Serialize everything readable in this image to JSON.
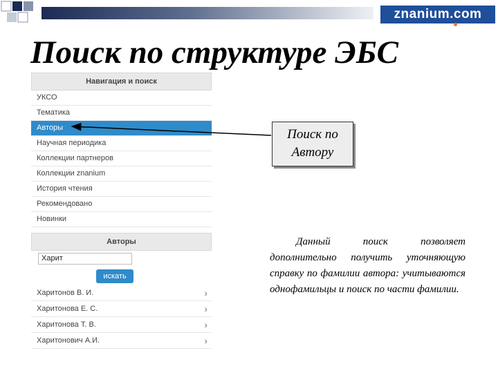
{
  "slide": {
    "title": "Поиск по структуре ЭБС",
    "brand": "znanium.com",
    "colors": {
      "accent": "#2f8bc9",
      "brand": "#1f4e9a",
      "title_bar_dark": "#1c2a55"
    }
  },
  "navigation": {
    "header": "Навигация и поиск",
    "items": [
      {
        "label": "УКСО",
        "active": false
      },
      {
        "label": "Тематика",
        "active": false
      },
      {
        "label": "Авторы",
        "active": true
      },
      {
        "label": "Научная периодика",
        "active": false
      },
      {
        "label": "Коллекции партнеров",
        "active": false
      },
      {
        "label": "Коллекции znanium",
        "active": false
      },
      {
        "label": "История чтения",
        "active": false
      },
      {
        "label": "Рекомендовано",
        "active": false
      },
      {
        "label": "Новинки",
        "active": false
      }
    ]
  },
  "authors": {
    "header": "Авторы",
    "search_value": "Харит",
    "search_button": "искать",
    "results": [
      "Харитонов В. И.",
      "Харитонова Е. С.",
      "Харитонова Т. В.",
      "Харитонович А.И."
    ],
    "result_icon": "chevron-right-icon"
  },
  "callout": {
    "lines": [
      "Поиск по",
      "Автору"
    ]
  },
  "description": "Данный поиск позволяет дополнительно получить уточняющую справку по фамилии автора: учитываются однофамильцы и поиск по части фамилии."
}
